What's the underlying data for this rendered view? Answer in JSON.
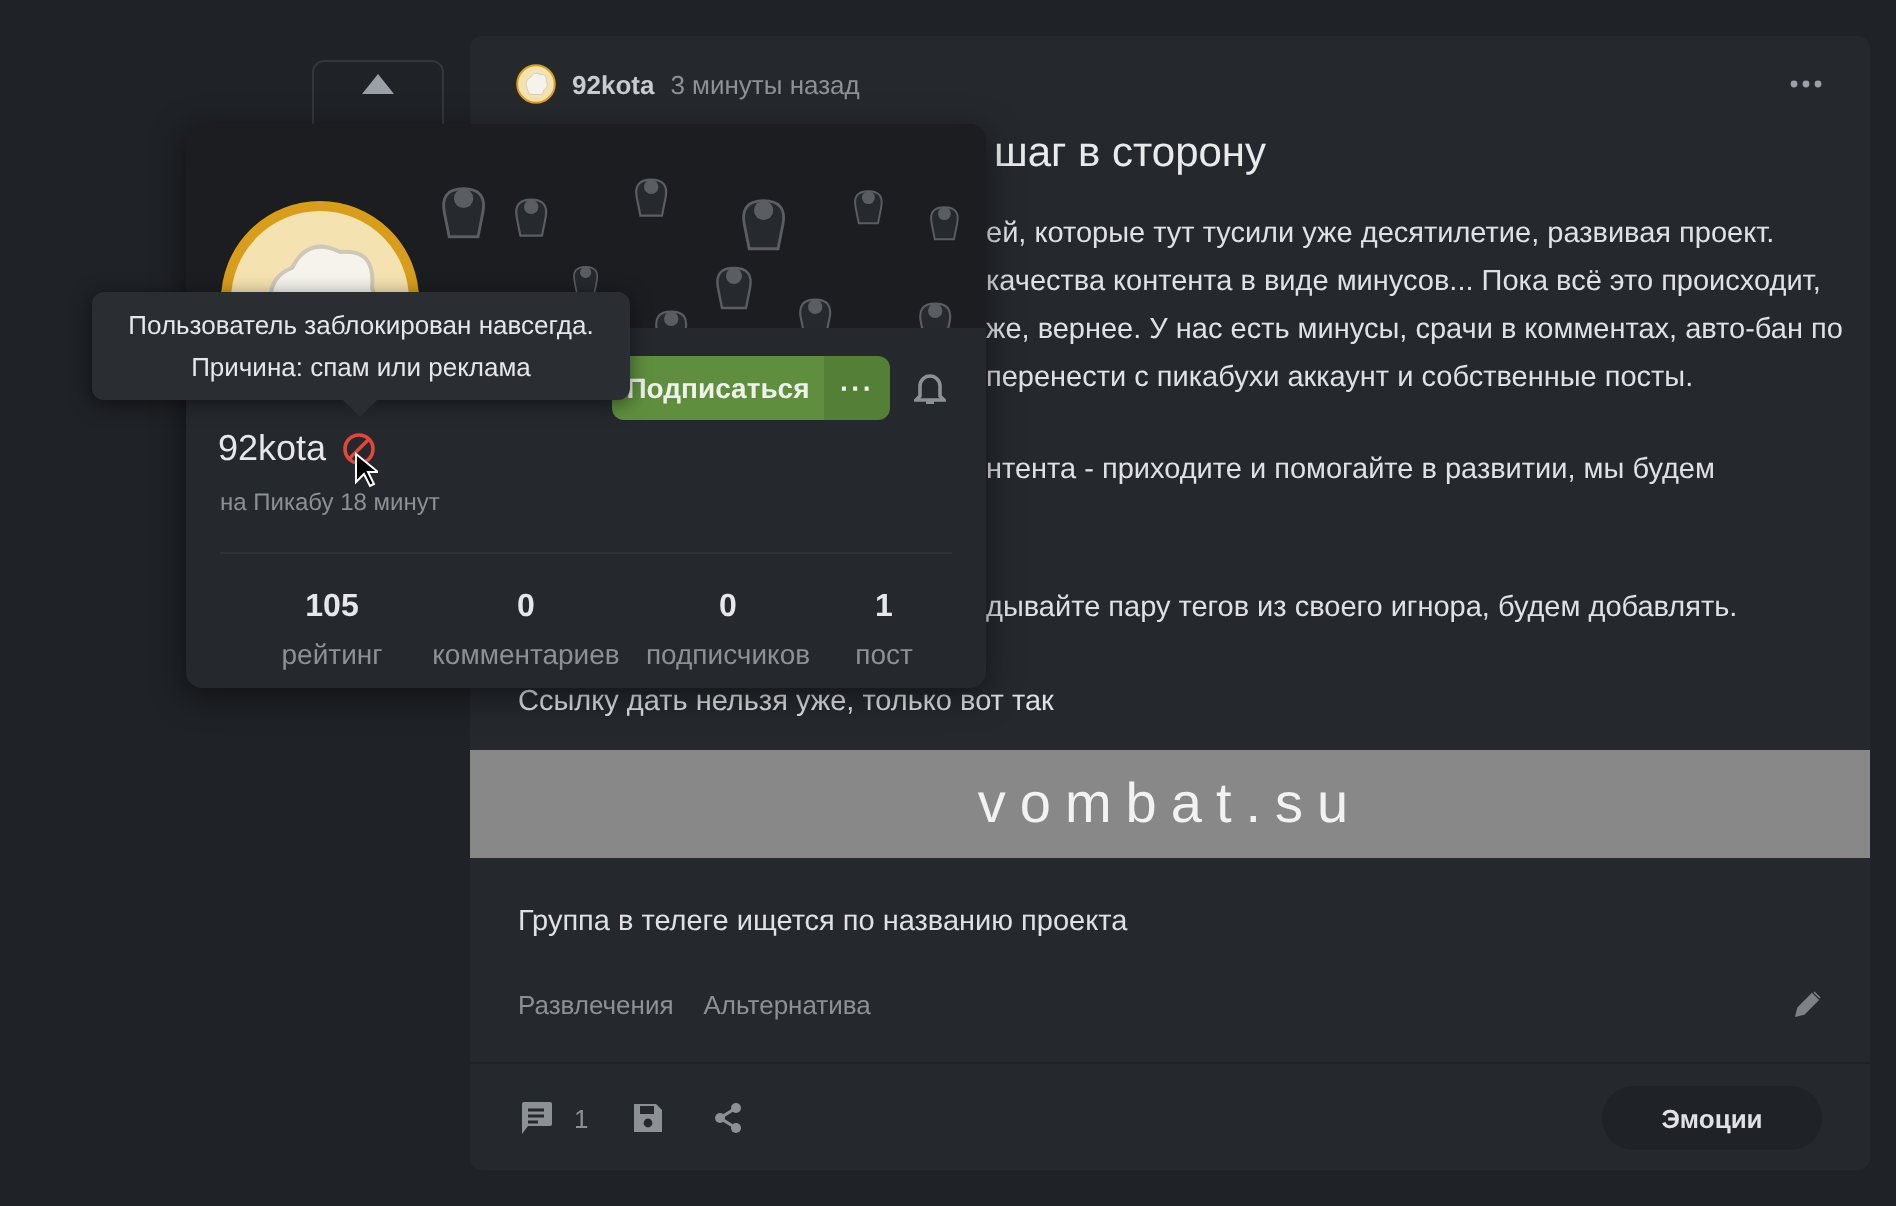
{
  "post": {
    "author": "92kota",
    "time": "3 минуты назад",
    "title": "шаг в сторону",
    "paragraphs": [
      [
        "ей, которые тут тусили уже десятилетие, развивая проект.",
        "качества контента в виде минусов... Пока всё это происходит,",
        "же, вернее. У нас есть минусы, срачи в комментах, авто-бан по",
        "перенести с пикабухи аккаунт и собственные посты."
      ],
      [
        "нтента - приходите и помогайте в развитии, мы будем"
      ],
      [
        "дывайте пару тегов из своего игнора, будем добавлять."
      ]
    ],
    "link_line": "Ссылку дать нельзя уже, только вот так",
    "banner_text": "vombat.su",
    "caption": "Группа в телеге ищется по названию проекта",
    "tags": [
      "Развлечения",
      "Альтернатива"
    ],
    "comments_count": "1",
    "emotions_button": "Эмоции"
  },
  "profile_popup": {
    "username": "92kota",
    "banned": true,
    "member_for": "на Пикабу 18 минут",
    "subscribe_button": "Подписаться",
    "more_button": "···",
    "stats": [
      {
        "value": "105",
        "label": "рейтинг"
      },
      {
        "value": "0",
        "label": "комментариев"
      },
      {
        "value": "0",
        "label": "подписчиков"
      },
      {
        "value": "1",
        "label": "пост"
      }
    ]
  },
  "tooltip": {
    "lines": [
      "Пользователь заблокирован навсегда.",
      "Причина: спам или реклама"
    ]
  }
}
